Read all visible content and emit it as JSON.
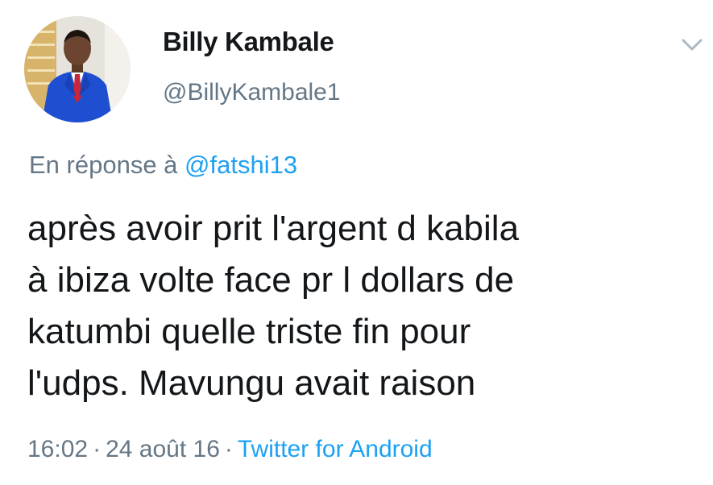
{
  "tweet": {
    "author": {
      "display_name": "Billy Kambale",
      "handle": "@BillyKambale1"
    },
    "reply": {
      "prefix": "En réponse à",
      "mention": "@fatshi13"
    },
    "text_lines": [
      "après avoir prit l'argent d kabila",
      "à ibiza volte face pr l dollars de",
      "katumbi quelle triste fin pour",
      "l'udps. Mavungu avait raison"
    ],
    "meta": {
      "time": "16:02",
      "separator": "·",
      "date": "24 août 16",
      "source": "Twitter for Android"
    },
    "icons": {
      "menu": "chevron-down-icon"
    },
    "colors": {
      "text": "#14171a",
      "secondary": "#657786",
      "link": "#1da1f2"
    }
  }
}
